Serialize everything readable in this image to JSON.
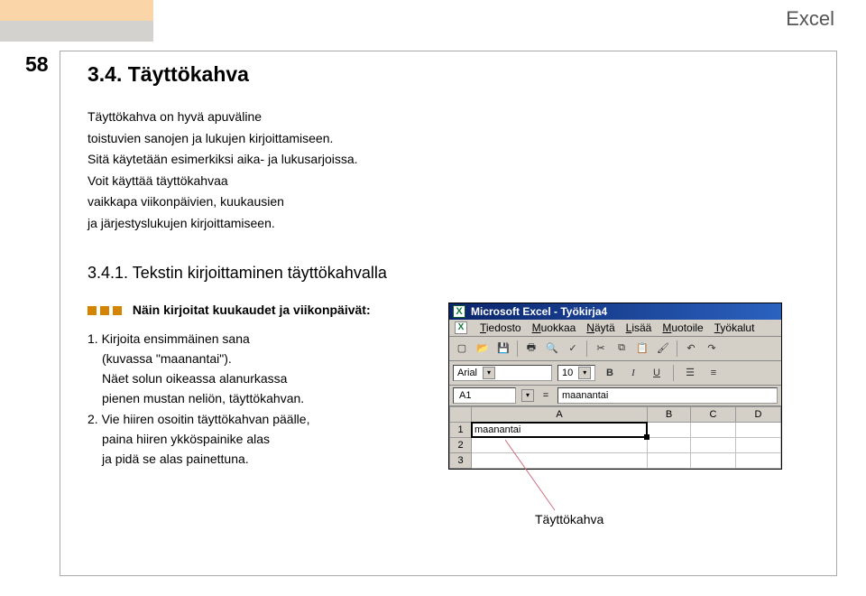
{
  "app_title": "Excel",
  "page_number": "58",
  "section": {
    "heading": "3.4. Täyttökahva",
    "intro": [
      "Täyttökahva on hyvä apuväline",
      "toistuvien sanojen ja lukujen kirjoittamiseen.",
      "Sitä käytetään esimerkiksi aika- ja lukusarjoissa.",
      "Voit käyttää täyttökahvaa",
      "vaikkapa viikonpäivien, kuukausien",
      "ja järjestyslukujen kirjoittamiseen."
    ],
    "sub_heading": "3.4.1. Tekstin kirjoittaminen täyttökahvalla",
    "lead": "Näin kirjoitat kuukaudet ja viikonpäivät:",
    "steps": [
      {
        "num": "1.",
        "lines": [
          "Kirjoita ensimmäinen sana",
          "(kuvassa \"maanantai\").",
          "Näet solun oikeassa alanurkassa",
          "pienen mustan neliön, täyttökahvan."
        ]
      },
      {
        "num": "2.",
        "lines": [
          "Vie hiiren osoitin täyttökahvan päälle,",
          "paina hiiren ykköspainike alas",
          "ja pidä se alas painettuna."
        ]
      }
    ]
  },
  "excel_mock": {
    "title_prefix": "Microsoft Excel - ",
    "workbook": "Työkirja4",
    "menus": [
      {
        "u": "T",
        "rest": "iedosto"
      },
      {
        "u": "M",
        "rest": "uokkaa"
      },
      {
        "u": "N",
        "rest": "äytä"
      },
      {
        "u": "L",
        "rest": "isää"
      },
      {
        "u": "M",
        "rest": "uotoile"
      },
      {
        "u": "T",
        "rest": "yökalut"
      }
    ],
    "font_name": "Arial",
    "font_size": "10",
    "namebox": "A1",
    "formula_value": "maanantai",
    "columns": [
      "A",
      "B",
      "C",
      "D"
    ],
    "rows": [
      "1",
      "2",
      "3"
    ],
    "cell_a1": "maanantai",
    "bold": "B",
    "italic": "I",
    "underline": "U"
  },
  "callout": "Täyttökahva"
}
